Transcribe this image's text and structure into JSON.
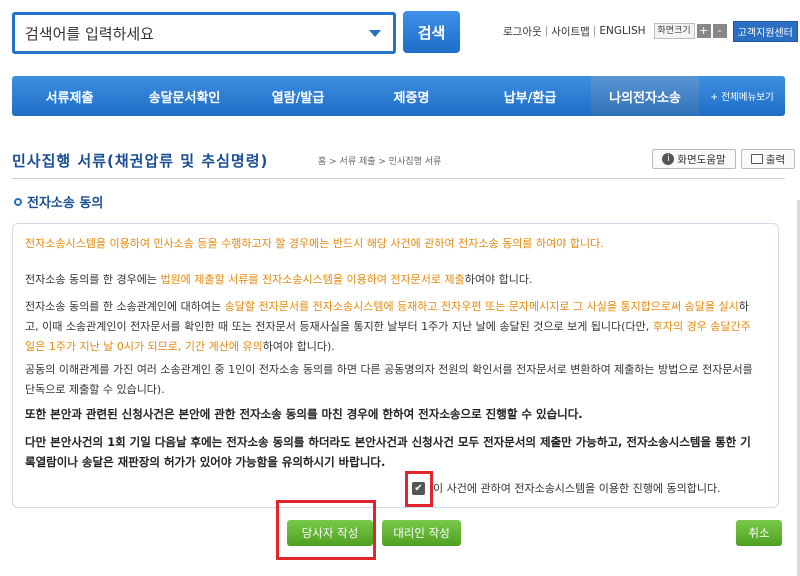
{
  "search": {
    "placeholder": "검색어를 입력하세요",
    "button": "검색"
  },
  "util": {
    "logout": "로그아웃",
    "sitemap": "사이트맵",
    "english": "ENGLISH",
    "font_size": "화면크기",
    "plus": "+",
    "minus": "-",
    "customer_center": "고객지원센터"
  },
  "nav": {
    "items": [
      "서류제출",
      "송달문서확인",
      "열람/발급",
      "제증명",
      "납부/환급",
      "나의전자소송"
    ],
    "all_menu": "+ 전체메뉴보기",
    "active_index": 5
  },
  "page": {
    "title": "민사집행 서류(채권압류 및 추심명령)",
    "breadcrumb": "홈 > 서류 제출 > 민사집행 서류",
    "help": "화면도움말",
    "print": "출력"
  },
  "section": {
    "title": "전자소송 동의"
  },
  "content": {
    "p1": "전자소송시스템을 이용하여 민사소송 등을 수행하고자 할 경우에는 반드시 해당 사건에 관하여 전자소송 동의를 하여야 합니다.",
    "p2_a": "전자소송 동의를 한 경우에는 ",
    "p2_b": "법원에 제출할 서류를 전자소송시스템을 이용하여 전자문서로 제출",
    "p2_c": "하여야 합니다.",
    "p3_a": "전자소송 동의를 한 소송관계인에 대하여는 ",
    "p3_b": "송달할 전자문서를 전자소송시스템에 등재하고 전자우편 또는 문자메시지로 그 사실을 통지합으로써 송달을 실시",
    "p3_c": "하고, 이때 소송관계인이 전자문서를 확인한 때 또는 전자문서 등재사실을 통지한 날부터 1주가 지난 날에 송달된 것으로 보게 됩니다(다만, ",
    "p3_d": "후자의 경우 송달간주일은 1주가 지난 날 0시가 되므로, 기간 계산에 유의",
    "p3_e": "하여야 합니다).",
    "p4": "공동의 이해관계를 가진 여러 소송관계인 중 1인이 전자소송 동의를 하면 다른 공동명의자 전원의 확인서를 전자문서로 변환하여 제출하는 방법으로 전자문서를 단독으로 제출할 수 있습니다).",
    "p5": "또한 본안과 관련된 신청사건은 본안에 관한 전자소송 동의를 마친 경우에 한하여 전자소송으로 진행할 수 있습니다.",
    "p6": "다만 본안사건의 1회 기일 다음날 후에는 전자소송 동의를 하더라도 본안사건과 신청사건 모두 전자문서의 제출만 가능하고, 전자소송시스템을 통한 기록열람이나 송달은 재판장의 허가가 있어야 가능함을 유의하시기 바랍니다.",
    "agree": "이 사건에 관하여 전자소송시스템을 이용한 진행에 동의합니다.",
    "agree_checked": true
  },
  "buttons": {
    "party": "당사자 작성",
    "agent": "대리인 작성",
    "cancel": "취소"
  }
}
